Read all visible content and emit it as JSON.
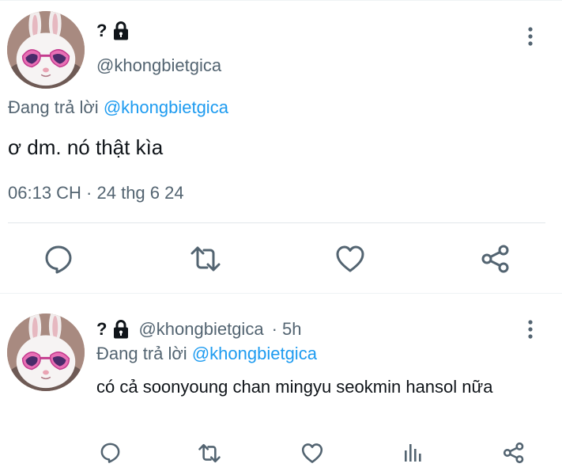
{
  "main_tweet": {
    "display_name": "?",
    "handle": "@khongbietgica",
    "reply_prefix": "Đang trả lời",
    "reply_to": "@khongbietgica",
    "text": "ơ dm. nó thật kìa",
    "timestamp": "06:13 CH · 24 thg 6 24",
    "icons": {
      "lock": "lock-icon",
      "more": "more-vertical-icon",
      "reply": "comment-icon",
      "retweet": "retweet-icon",
      "like": "heart-icon",
      "share": "share-icon"
    }
  },
  "reply_tweet": {
    "display_name": "?",
    "handle": "@khongbietgica",
    "time_ago": "· 5h",
    "reply_prefix": "Đang trả lời",
    "reply_to": "@khongbietgica",
    "text": "có cả soonyoung chan mingyu seokmin hansol nữa",
    "icons": {
      "lock": "lock-icon",
      "more": "more-vertical-icon",
      "reply": "comment-icon",
      "retweet": "retweet-icon",
      "like": "heart-icon",
      "analytics": "analytics-icon",
      "share": "share-icon"
    }
  },
  "colors": {
    "accent": "#1d9bf0",
    "secondary_text": "#536471",
    "primary_text": "#0f1419",
    "icon": "#536471",
    "divider": "#e1e6ea"
  }
}
